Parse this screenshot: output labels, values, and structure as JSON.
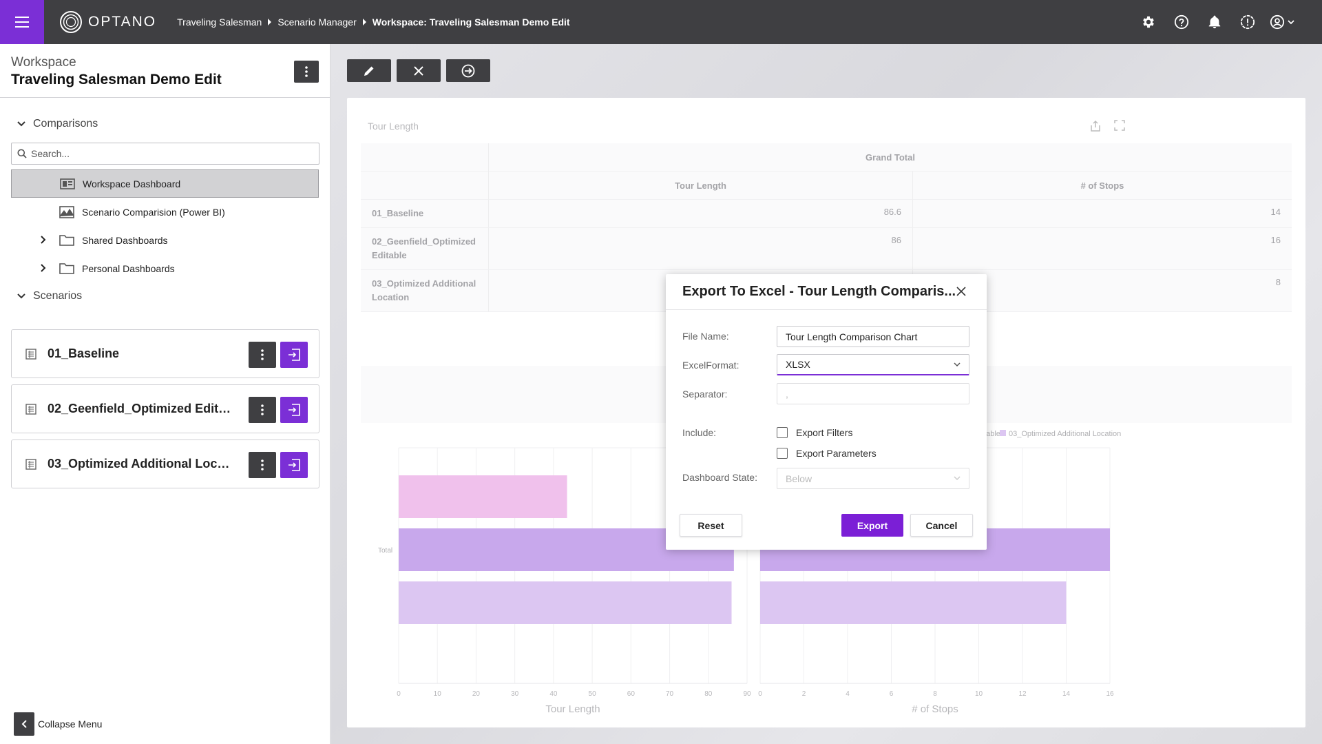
{
  "topbar": {
    "logo_text": "OPTANO",
    "breadcrumbs": [
      "Traveling Salesman",
      "Scenario Manager",
      "Workspace: Traveling Salesman Demo Edit"
    ],
    "icons": [
      "gear-icon",
      "help-icon",
      "bell-icon",
      "alert-icon",
      "user-icon"
    ]
  },
  "sidebar": {
    "workspace_label": "Workspace",
    "workspace_name": "Traveling Salesman Demo Edit",
    "comparisons_label": "Comparisons",
    "search_placeholder": "Search...",
    "items": [
      {
        "label": "Workspace Dashboard",
        "icon": "dashboard-icon",
        "selected": true
      },
      {
        "label": "Scenario Comparision (Power BI)",
        "icon": "chart-icon"
      },
      {
        "label": "Shared Dashboards",
        "icon": "folder-icon"
      },
      {
        "label": "Personal Dashboards",
        "icon": "folder-icon"
      }
    ],
    "scenarios_label": "Scenarios",
    "scenarios": [
      {
        "name": "01_Baseline"
      },
      {
        "name": "02_Geenfield_Optimized Editable"
      },
      {
        "name": "03_Optimized Additional Location"
      }
    ],
    "collapse_label": "Collapse Menu"
  },
  "toolbar": {
    "buttons": [
      "pencil-icon",
      "close-icon",
      "arrow-circle-icon"
    ]
  },
  "dashboard": {
    "title": "Tour Length",
    "pivot": {
      "grand_total": "Grand Total",
      "col1": "Tour Length",
      "col2": "# of Stops",
      "rows": [
        {
          "label": "01_Baseline",
          "v1": "86.6",
          "v2": "14"
        },
        {
          "label": "02_Geenfield_Optimized Editable",
          "v1": "86",
          "v2": "16"
        },
        {
          "label": "03_Optimized Additional Location",
          "v1": "",
          "v2": "8"
        }
      ]
    }
  },
  "chart_data": {
    "type": "bar",
    "orientation": "horizontal",
    "category": "Total",
    "legend": [
      "02_Geenfield_Optimized Editable",
      "03_Optimized Additional Location"
    ],
    "legend_position": "top-right",
    "series_colors": [
      "#f0c1ec",
      "#c8a8ec",
      "#dcc6f2"
    ],
    "panels": [
      {
        "xlabel": "Tour Length",
        "xlim": [
          0,
          90
        ],
        "ticks": [
          0,
          10,
          20,
          30,
          40,
          50,
          60,
          70,
          80,
          90
        ],
        "values": [
          43.5,
          86.6,
          86
        ]
      },
      {
        "xlabel": "# of Stops",
        "xlim": [
          0,
          16
        ],
        "ticks": [
          0,
          2,
          4,
          6,
          8,
          10,
          12,
          14,
          16
        ],
        "values": [
          8,
          16,
          14
        ]
      }
    ],
    "grid": true
  },
  "modal": {
    "title": "Export To Excel - Tour Length Comparis...",
    "file_name_label": "File Name:",
    "file_name_value": "Tour Length Comparison Chart",
    "format_label": "ExcelFormat:",
    "format_value": "XLSX",
    "separator_label": "Separator:",
    "separator_value": ",",
    "include_label": "Include:",
    "export_filters": "Export Filters",
    "export_parameters": "Export Parameters",
    "dashboard_state_label": "Dashboard State:",
    "dashboard_state_value": "Below",
    "reset": "Reset",
    "export": "Export",
    "cancel": "Cancel"
  }
}
